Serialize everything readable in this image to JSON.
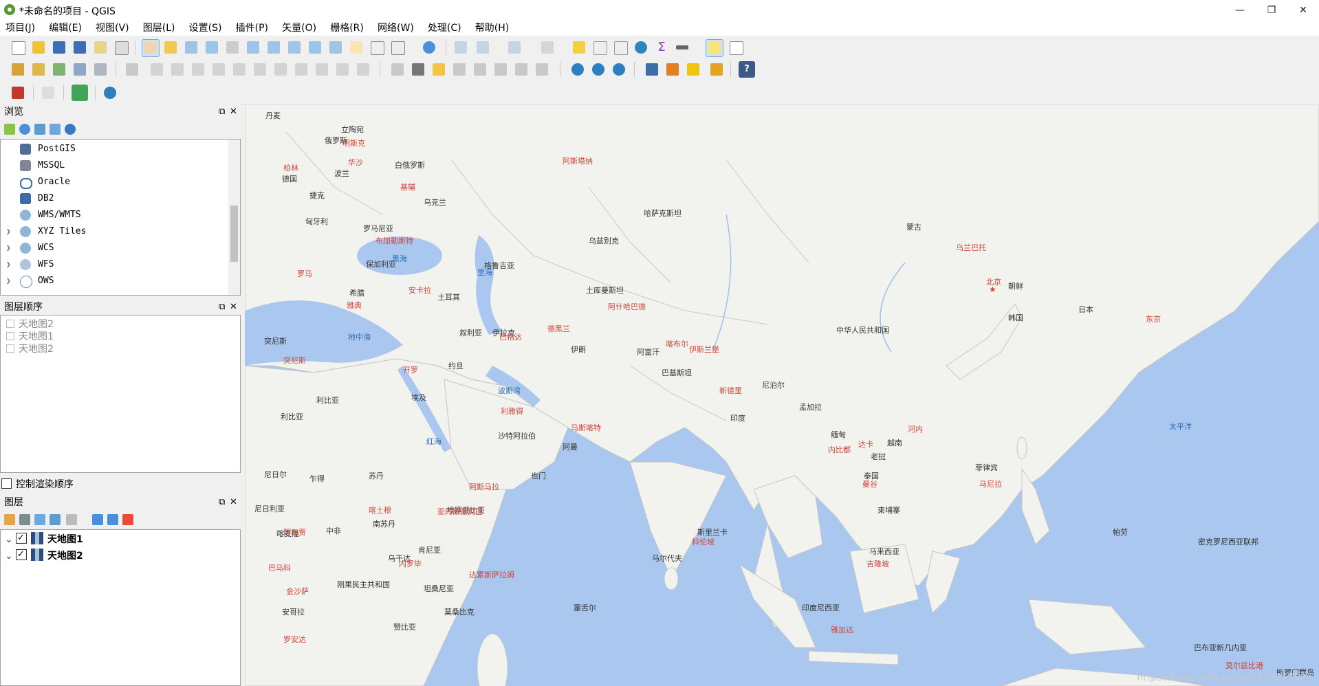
{
  "window": {
    "title": "*未命名的项目 - QGIS",
    "minimize": "—",
    "maximize": "❐",
    "close": "✕"
  },
  "menus": [
    "项目(J)",
    "编辑(E)",
    "视图(V)",
    "图层(L)",
    "设置(S)",
    "插件(P)",
    "矢量(O)",
    "栅格(R)",
    "网络(W)",
    "处理(C)",
    "帮助(H)"
  ],
  "browser": {
    "title": "浏览",
    "items": [
      {
        "label": "PostGIS",
        "icon": "postgis-icon",
        "expandable": false
      },
      {
        "label": "MSSQL",
        "icon": "mssql-icon",
        "expandable": false
      },
      {
        "label": "Oracle",
        "icon": "oracle-icon",
        "expandable": false
      },
      {
        "label": "DB2",
        "icon": "db2-icon",
        "expandable": false
      },
      {
        "label": "WMS/WMTS",
        "icon": "globe-icon",
        "expandable": false
      },
      {
        "label": "XYZ Tiles",
        "icon": "globe-icon",
        "expandable": true
      },
      {
        "label": "WCS",
        "icon": "globe-icon",
        "expandable": true
      },
      {
        "label": "WFS",
        "icon": "wfs-icon",
        "expandable": true
      },
      {
        "label": "OWS",
        "icon": "globe-icon",
        "expandable": true
      }
    ]
  },
  "layer_order": {
    "title": "图层顺序",
    "items": [
      "天地图2",
      "天地图1",
      "天地图2"
    ],
    "control_render_order": "控制渲染顺序"
  },
  "layers": {
    "title": "图层",
    "items": [
      {
        "label": "天地图1",
        "checked": true
      },
      {
        "label": "天地图2",
        "checked": true
      }
    ]
  },
  "map_labels": {
    "countries": [
      "丹麦",
      "立陶宛",
      "俄罗斯",
      "白俄罗斯",
      "德国",
      "波兰",
      "乌克兰",
      "捷克",
      "匈牙利",
      "罗马尼亚",
      "保加利亚",
      "希腊",
      "土耳其",
      "格鲁吉亚",
      "哈萨克斯坦",
      "蒙古",
      "乌兹别克",
      "土库曼斯坦",
      "叙利亚",
      "伊拉克",
      "伊朗",
      "阿富汗",
      "巴基斯坦",
      "约旦",
      "沙特阿拉伯",
      "埃及",
      "利比亚",
      "突尼斯",
      "阿曼",
      "也门",
      "尼泊尔",
      "印度",
      "中华人民共和国",
      "朝鲜",
      "韩国",
      "日本",
      "孟加拉",
      "缅甸",
      "老挝",
      "越南",
      "泰国",
      "柬埔寨",
      "菲律宾",
      "马来西亚",
      "印度尼西亚",
      "斯里兰卡",
      "马尔代夫",
      "尼日尔",
      "乍得",
      "苏丹",
      "尼日利亚",
      "中非",
      "埃塞俄比亚",
      "南苏丹",
      "喀麦隆",
      "刚果民主共和国",
      "肯尼亚",
      "乌干达",
      "坦桑尼亚",
      "安哥拉",
      "赞比亚",
      "莫桑比克",
      "塞舌尔",
      "巴布亚新几内亚",
      "帕劳",
      "所罗门群岛",
      "密克罗尼西亚联邦",
      "利比亚"
    ],
    "cities": [
      "明斯克",
      "华沙",
      "柏林",
      "基辅",
      "布加勒斯特",
      "安卡拉",
      "雅典",
      "巴格达",
      "德黑兰",
      "阿什哈巴德",
      "开罗",
      "利雅得",
      "马斯喀特",
      "喀布尔",
      "伊斯兰堡",
      "新德里",
      "北京",
      "东京",
      "达卡",
      "内比都",
      "河内",
      "曼谷",
      "马尼拉",
      "吉隆坡",
      "雅加达",
      "乌兰巴托",
      "阿斯塔纳",
      "亚的斯亚贝巴",
      "内罗毕",
      "达累斯萨拉姆",
      "金沙萨",
      "罗安达",
      "喀土穆",
      "阿布贾",
      "科伦坡",
      "莫尔兹比港",
      "阿斯马拉",
      "突尼斯",
      "罗马",
      "巴马科"
    ],
    "seas": [
      "黑海",
      "里海",
      "地中海",
      "红海",
      "波斯湾",
      "太平洋"
    ]
  },
  "watermark": "https://blog.csdn.net/qq_912917507"
}
